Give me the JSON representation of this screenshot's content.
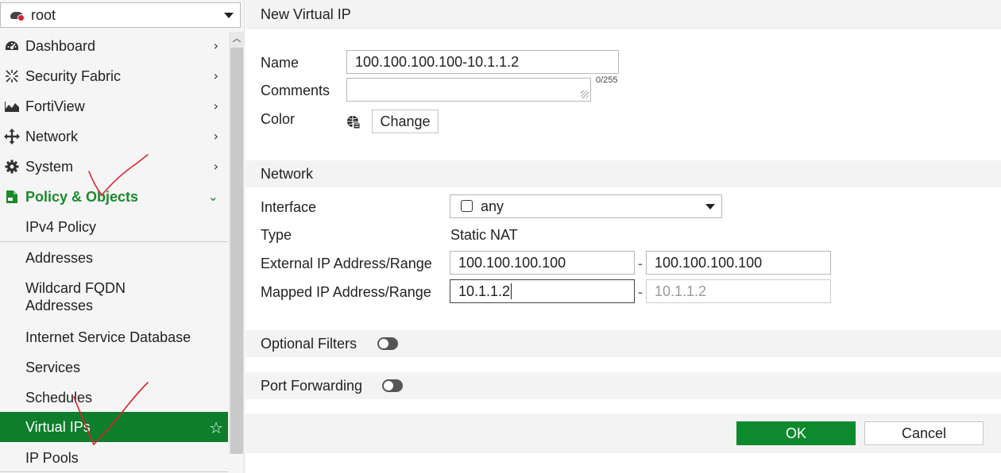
{
  "vdom": {
    "name": "root"
  },
  "sidebar": {
    "items": [
      {
        "label": "Dashboard",
        "icon": "dashboard-icon"
      },
      {
        "label": "Security Fabric",
        "icon": "security-fabric-icon"
      },
      {
        "label": "FortiView",
        "icon": "fortiview-icon"
      },
      {
        "label": "Network",
        "icon": "network-icon"
      },
      {
        "label": "System",
        "icon": "gear-icon"
      },
      {
        "label": "Policy & Objects",
        "icon": "policy-icon",
        "expanded": true
      }
    ],
    "subitems": [
      {
        "label": "IPv4 Policy"
      },
      {
        "label": "Addresses"
      },
      {
        "label": "Wildcard FQDN Addresses"
      },
      {
        "label": "Internet Service Database"
      },
      {
        "label": "Services"
      },
      {
        "label": "Schedules"
      },
      {
        "label": "Virtual IPs",
        "active": true
      },
      {
        "label": "IP Pools"
      }
    ]
  },
  "form": {
    "title": "New Virtual IP",
    "name_label": "Name",
    "name_value": "100.100.100.100-10.1.1.2",
    "comments_label": "Comments",
    "comments_value": "",
    "comments_counter": "0/255",
    "color_label": "Color",
    "change_button": "Change",
    "network_section": "Network",
    "interface_label": "Interface",
    "interface_value": "any",
    "type_label": "Type",
    "type_value": "Static NAT",
    "external_label": "External IP Address/Range",
    "external_start": "100.100.100.100",
    "external_end": "100.100.100.100",
    "mapped_label": "Mapped IP Address/Range",
    "mapped_start": "10.1.1.2",
    "mapped_end": "10.1.1.2",
    "range_separator": "-",
    "optional_filters": "Optional Filters",
    "port_forwarding": "Port Forwarding",
    "ok_button": "OK",
    "cancel_button": "Cancel"
  },
  "colors": {
    "accent_green": "#0e8a2e",
    "active_nav": "#0e7d2c",
    "annotation_red": "#d9232e"
  }
}
